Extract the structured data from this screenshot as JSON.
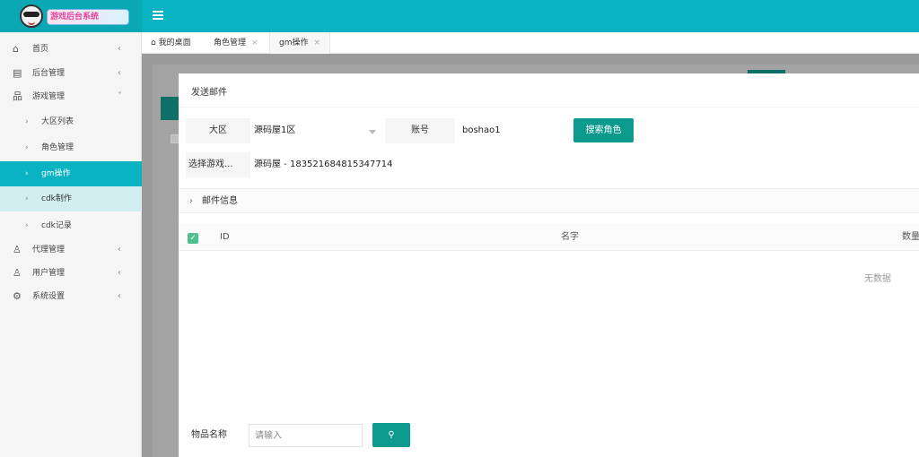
{
  "header": {
    "logo_text": "游戏后台系统"
  },
  "sidebar": {
    "items": [
      {
        "label": "首页",
        "icon": "home-icon"
      },
      {
        "label": "后台管理",
        "icon": "admin-icon"
      },
      {
        "label": "游戏管理",
        "icon": "sitemap-icon"
      },
      {
        "label": "大区列表"
      },
      {
        "label": "角色管理"
      },
      {
        "label": "gm操作"
      },
      {
        "label": "cdk制作"
      },
      {
        "label": "cdk记录"
      },
      {
        "label": "代理管理",
        "icon": "user-icon"
      },
      {
        "label": "用户管理",
        "icon": "user-icon"
      },
      {
        "label": "系统设置",
        "icon": "gear-icon"
      }
    ]
  },
  "tabs": [
    {
      "label": "我的桌面"
    },
    {
      "label": "角色管理"
    },
    {
      "label": "gm操作"
    }
  ],
  "dialog": {
    "title": "发送邮件",
    "region_label": "大区",
    "region_value": "源码屋1区",
    "account_label": "账号",
    "account_value": "boshao1",
    "search_role_button": "搜索角色",
    "select_role_label": "选择游戏...",
    "select_role_value": "源码屋 - 183521684815347714",
    "mail_info_label": "邮件信息",
    "table": {
      "columns": [
        "ID",
        "名字",
        "数量"
      ],
      "empty_text": "无数据"
    },
    "item_name_label": "物品名称",
    "item_name_placeholder": "请输入"
  },
  "colors": {
    "brand": "#0ab3c2",
    "primary_button": "#0b9a8d"
  }
}
